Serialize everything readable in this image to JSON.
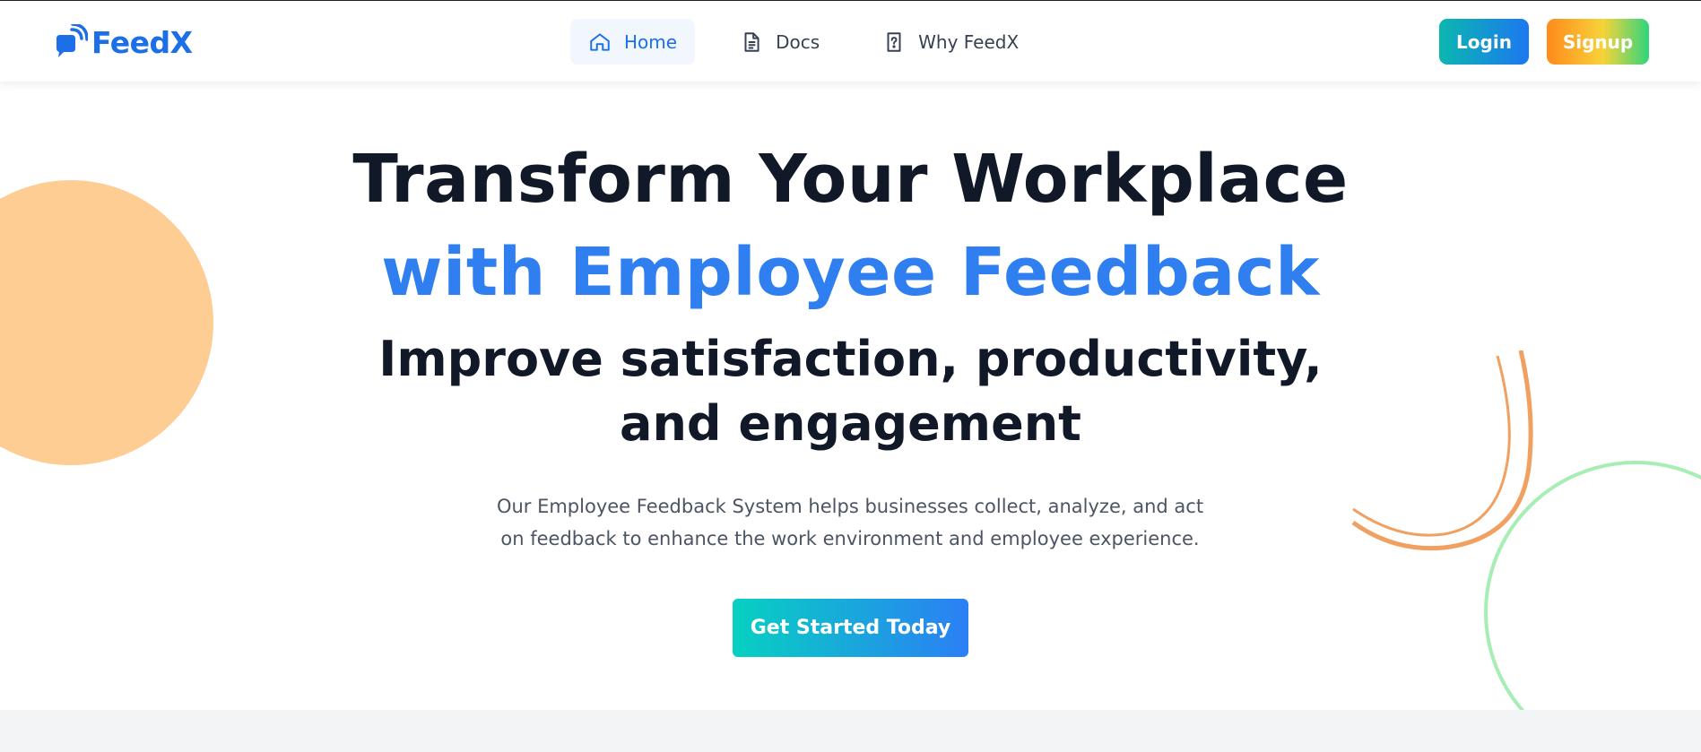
{
  "brand": {
    "name": "FeedX",
    "color": "#1d6fe8",
    "icon": "chat-signal-logo-icon"
  },
  "nav": {
    "items": [
      {
        "label": "Home",
        "icon": "home-icon",
        "active": true
      },
      {
        "label": "Docs",
        "icon": "document-icon",
        "active": false
      },
      {
        "label": "Why FeedX",
        "icon": "question-file-icon",
        "active": false
      }
    ]
  },
  "auth": {
    "login_label": "Login",
    "signup_label": "Signup"
  },
  "hero": {
    "headline_line1": "Transform Your Workplace",
    "headline_line2": "with Employee Feedback",
    "subheadline_line1": "Improve satisfaction, productivity,",
    "subheadline_line2": "and engagement",
    "description": "Our Employee Feedback System helps businesses collect, analyze, and act on feedback to enhance the work environment and employee experience.",
    "cta_label": "Get Started Today"
  },
  "colors": {
    "accent_blue": "#2f7ff0",
    "heading_dark": "#111827",
    "blob_orange": "#fdcd94",
    "arc_orange": "#f0a060",
    "arc_green": "#a6eeb4"
  }
}
